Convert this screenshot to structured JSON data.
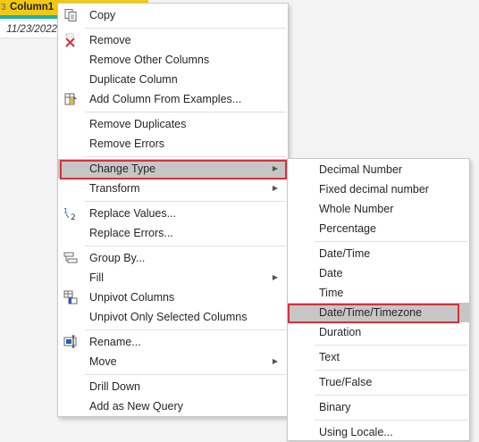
{
  "table": {
    "column_type_glyph": "3",
    "column_header": "Column1",
    "cell_value": "11/23/2022"
  },
  "context_menu": {
    "copy": "Copy",
    "remove": "Remove",
    "remove_other_columns": "Remove Other Columns",
    "duplicate_column": "Duplicate Column",
    "add_column_from_examples": "Add Column From Examples...",
    "remove_duplicates": "Remove Duplicates",
    "remove_errors": "Remove Errors",
    "change_type": "Change Type",
    "transform": "Transform",
    "replace_values": "Replace Values...",
    "replace_errors": "Replace Errors...",
    "group_by": "Group By...",
    "fill": "Fill",
    "unpivot_columns": "Unpivot Columns",
    "unpivot_only_selected_columns": "Unpivot Only Selected Columns",
    "rename": "Rename...",
    "move": "Move",
    "drill_down": "Drill Down",
    "add_as_new_query": "Add as New Query"
  },
  "change_type_submenu": {
    "decimal_number": "Decimal Number",
    "fixed_decimal_number": "Fixed decimal number",
    "whole_number": "Whole Number",
    "percentage": "Percentage",
    "datetime": "Date/Time",
    "date": "Date",
    "time": "Time",
    "datetimezone": "Date/Time/Timezone",
    "duration": "Duration",
    "text": "Text",
    "true_false": "True/False",
    "binary": "Binary",
    "using_locale": "Using Locale..."
  },
  "colors": {
    "header_accent": "#f2c811",
    "highlight_bg": "#c6c6c6",
    "annotation_red": "#d9313a",
    "teal_bar": "#1fb0a6"
  },
  "icons": {
    "copy": "copy-icon",
    "remove": "remove-x-icon",
    "examples": "add-column-examples-icon",
    "replace": "replace-values-icon",
    "group": "group-by-icon",
    "unpivot": "unpivot-icon",
    "rename": "rename-icon",
    "submenu_arrow": "chevron-right-icon"
  }
}
